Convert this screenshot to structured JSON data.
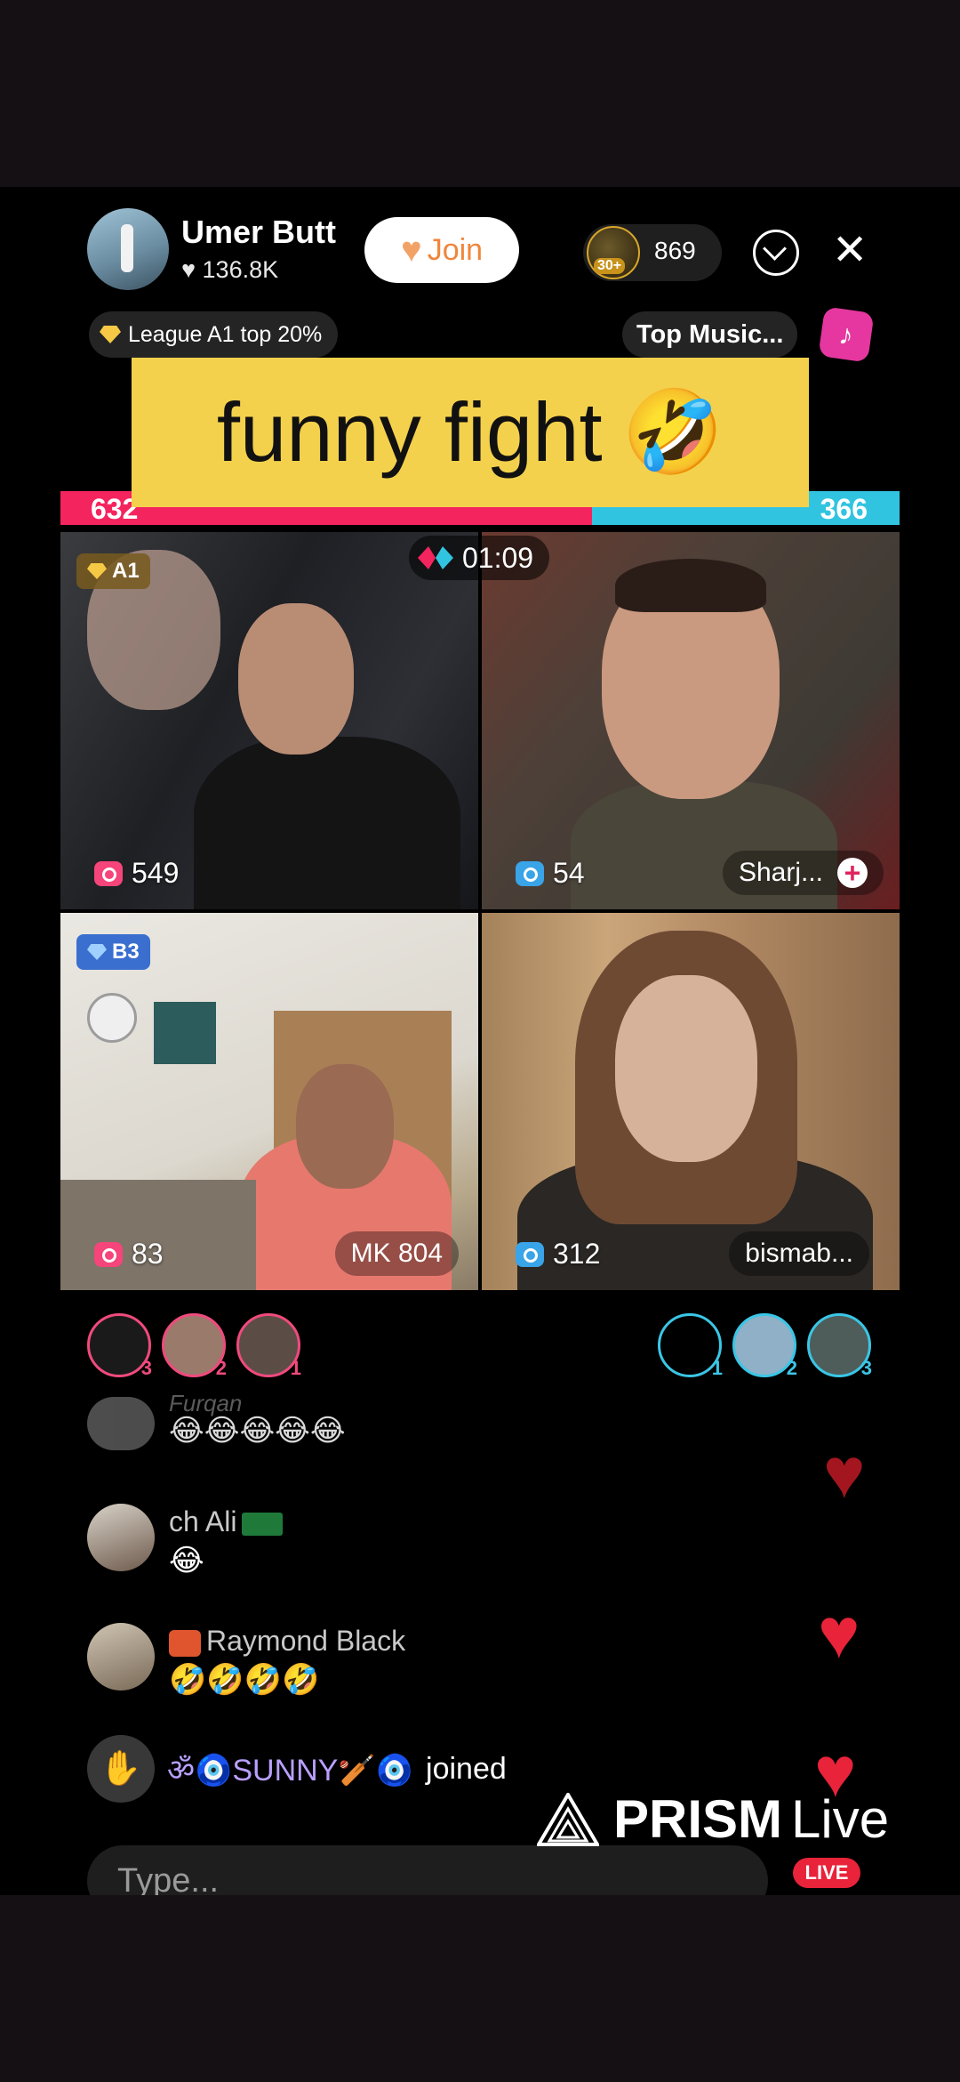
{
  "host": {
    "name": "Umer Butt",
    "likes": "♥ 136.8K",
    "join_label": "Join"
  },
  "header": {
    "viewer_badge": "30+",
    "viewer_count": "869",
    "close_glyph": "✕"
  },
  "league": {
    "text": "League A1 top 20%"
  },
  "music": {
    "label": "Top Music...",
    "icon": "music-note-icon"
  },
  "caption": {
    "text": "funny fight",
    "emoji": "🤣"
  },
  "battle": {
    "left_score": "632",
    "right_score": "366",
    "left_share": 0.633,
    "timer": "01:09",
    "left_color": "#f4245f",
    "right_color": "#31c4e0"
  },
  "tiles": [
    {
      "badge": "A1",
      "count": "549"
    },
    {
      "count": "54",
      "name": "Sharj...",
      "plus": "+"
    },
    {
      "badge": "B3",
      "count": "83",
      "name": "MK 804"
    },
    {
      "count": "312",
      "name": "bismab..."
    }
  ],
  "ranks": {
    "left": [
      "3",
      "2",
      "1"
    ],
    "right": [
      "1",
      "2",
      "3"
    ]
  },
  "chat": [
    {
      "name": "Furqan",
      "message": "😂😂😂😂😂"
    },
    {
      "name": "ch Ali",
      "message": "😂"
    },
    {
      "name": "Raymond Black",
      "message": "🤣🤣🤣🤣"
    }
  ],
  "join_event": {
    "name": "ॐ🧿SUNNY🏏🧿",
    "action": "joined"
  },
  "input": {
    "placeholder": "Type..."
  },
  "watermark": {
    "brand": "PRISM",
    "suffix": "Live",
    "badge": "LIVE"
  }
}
